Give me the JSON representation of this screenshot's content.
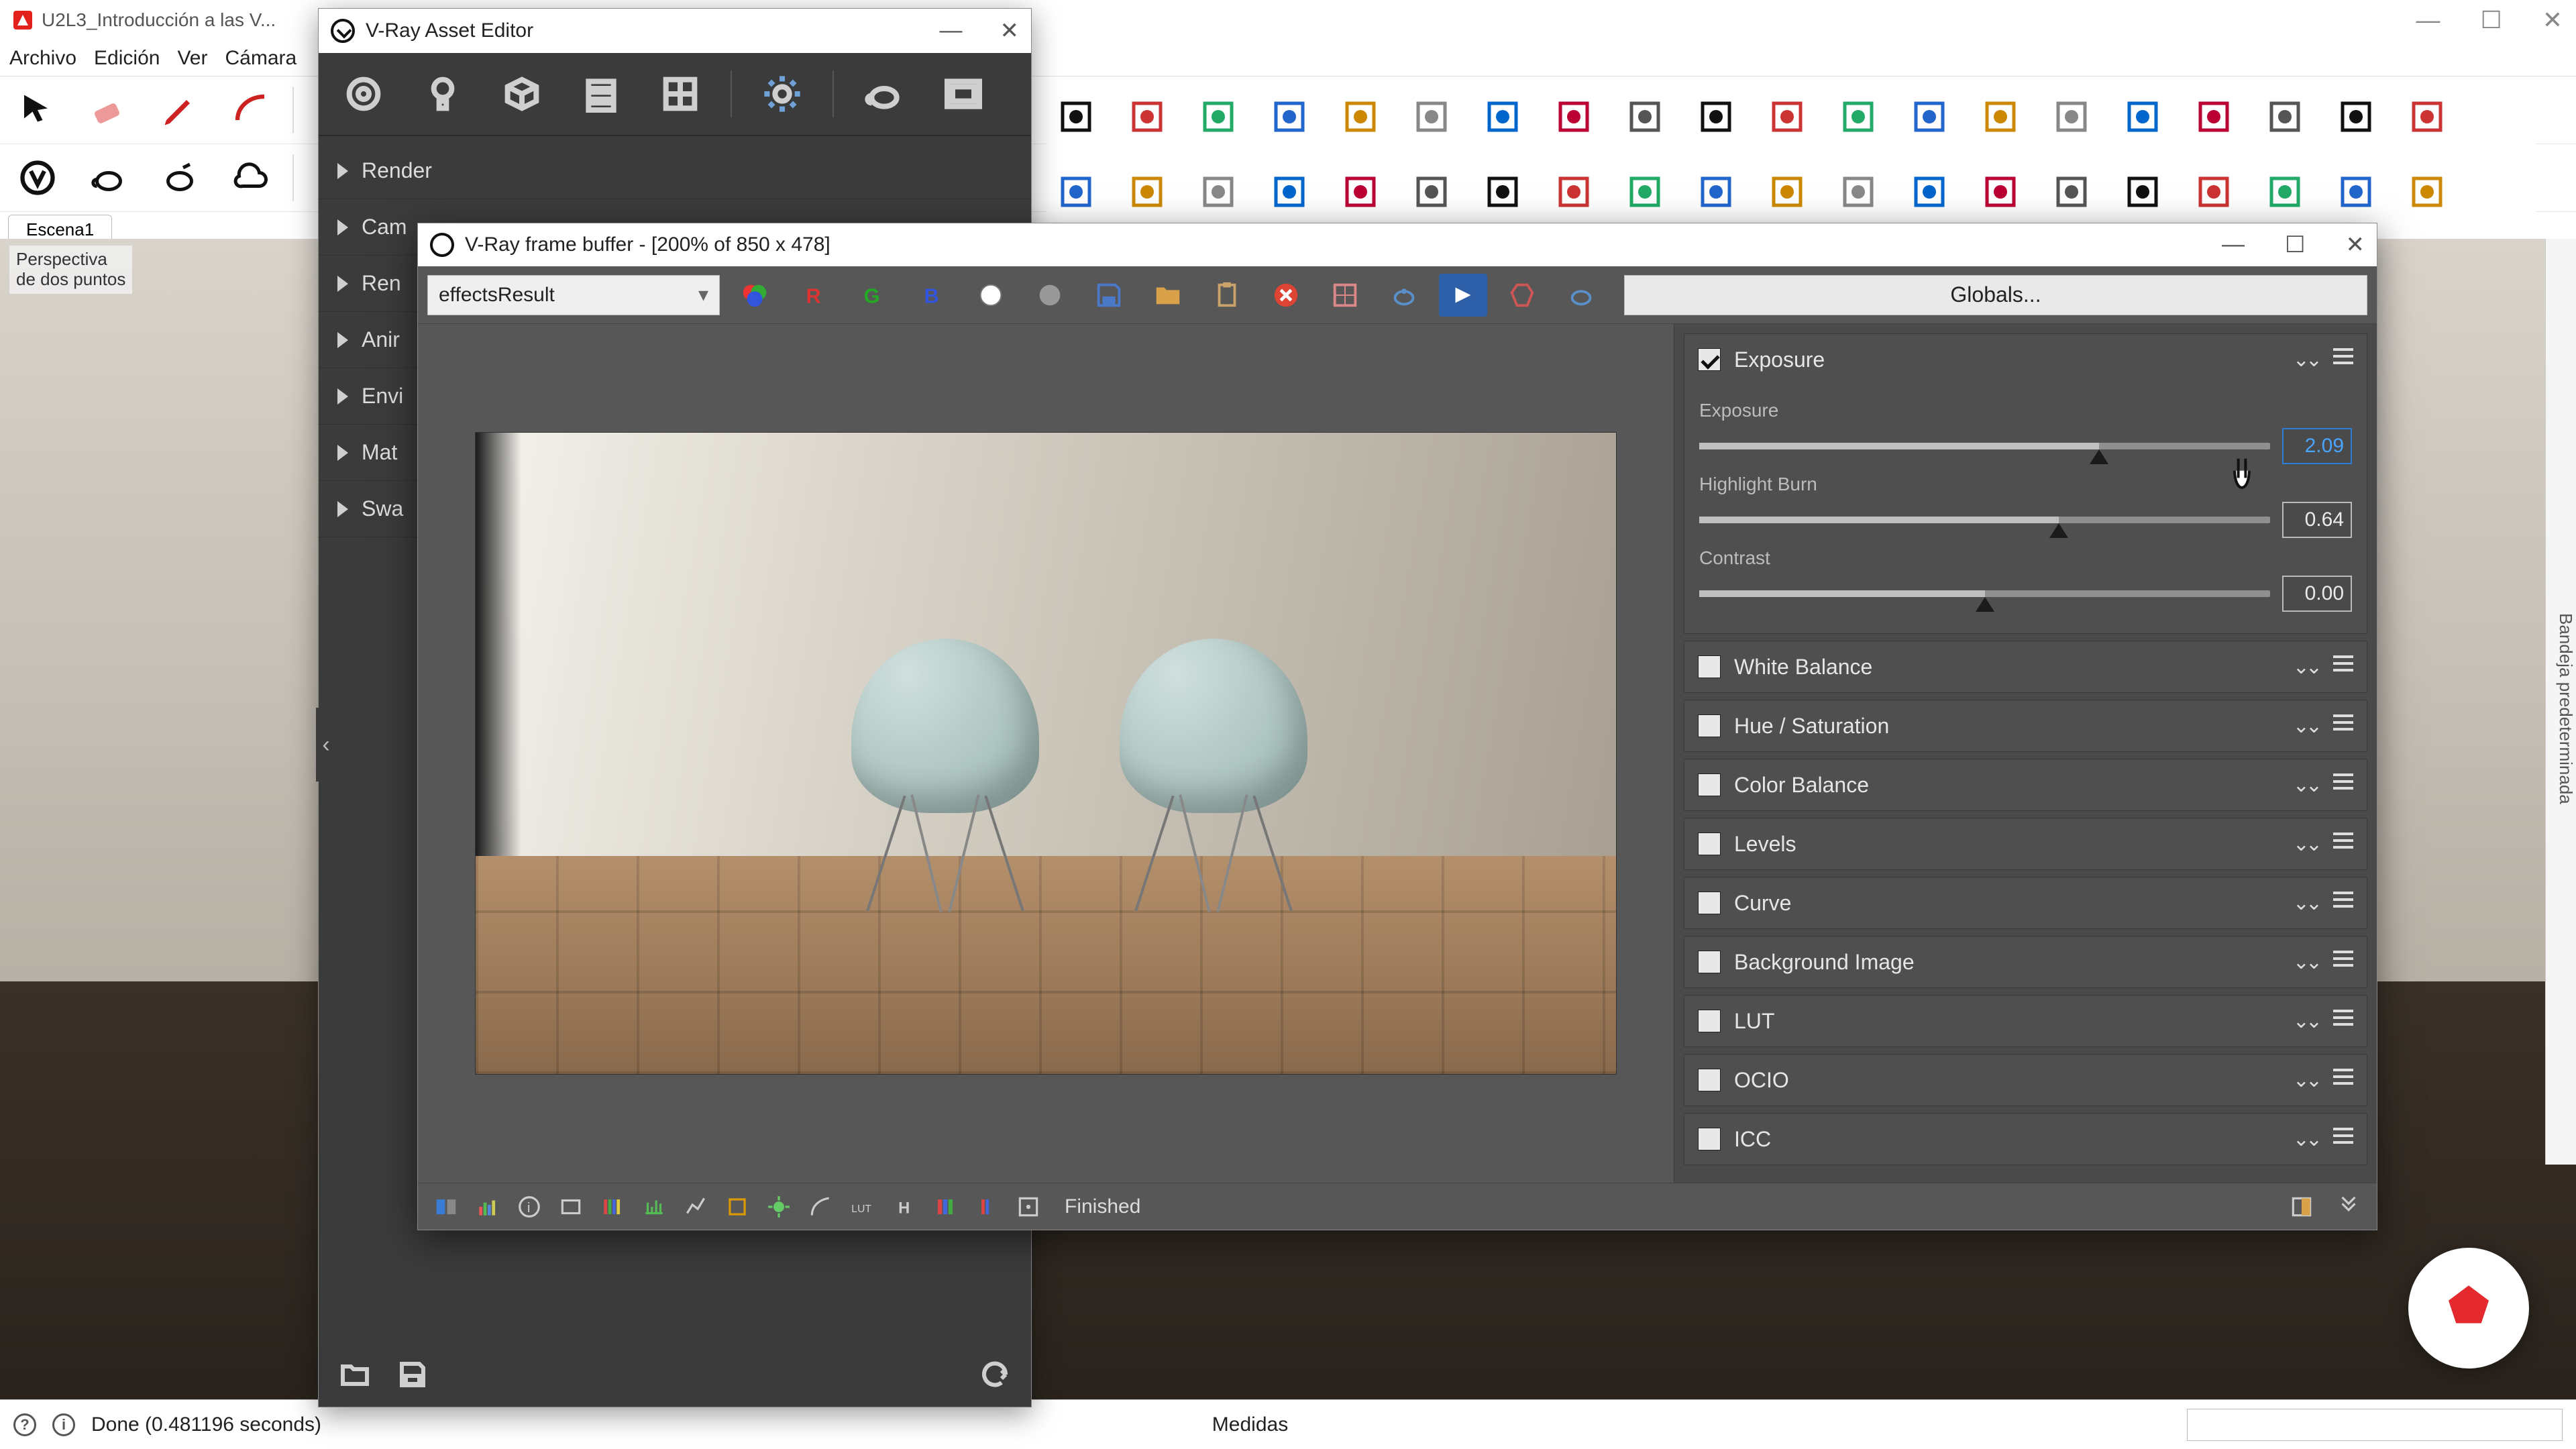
{
  "sketchup": {
    "title": "U2L3_Introducción a las V...",
    "menu": [
      "Archivo",
      "Edición",
      "Ver",
      "Cámara"
    ],
    "scene_tab": "Escena1",
    "perspective_label": "Perspectiva\nde dos puntos",
    "status_text": "Done (0.481196 seconds)",
    "measurements_label": "Medidas",
    "right_tray_label": "Bandeja predeterminada"
  },
  "asset_editor": {
    "title": "V-Ray Asset Editor",
    "tree": [
      "Render",
      "Cam",
      "Ren",
      "Anir",
      "Envi",
      "Mat",
      "Swa"
    ]
  },
  "vfb": {
    "title": "V-Ray frame buffer - [200% of 850 x 478]",
    "channel": "effectsResult",
    "globals_label": "Globals...",
    "status": "Finished",
    "corrections": {
      "exposure_section": "Exposure",
      "exposure": {
        "label": "Exposure",
        "value": "2.09",
        "pct": 70
      },
      "highlight_burn": {
        "label": "Highlight Burn",
        "value": "0.64",
        "pct": 63
      },
      "contrast": {
        "label": "Contrast",
        "value": "0.00",
        "pct": 50
      },
      "others": [
        "White Balance",
        "Hue / Saturation",
        "Color Balance",
        "Levels",
        "Curve",
        "Background Image",
        "LUT",
        "OCIO",
        "ICC"
      ]
    }
  }
}
